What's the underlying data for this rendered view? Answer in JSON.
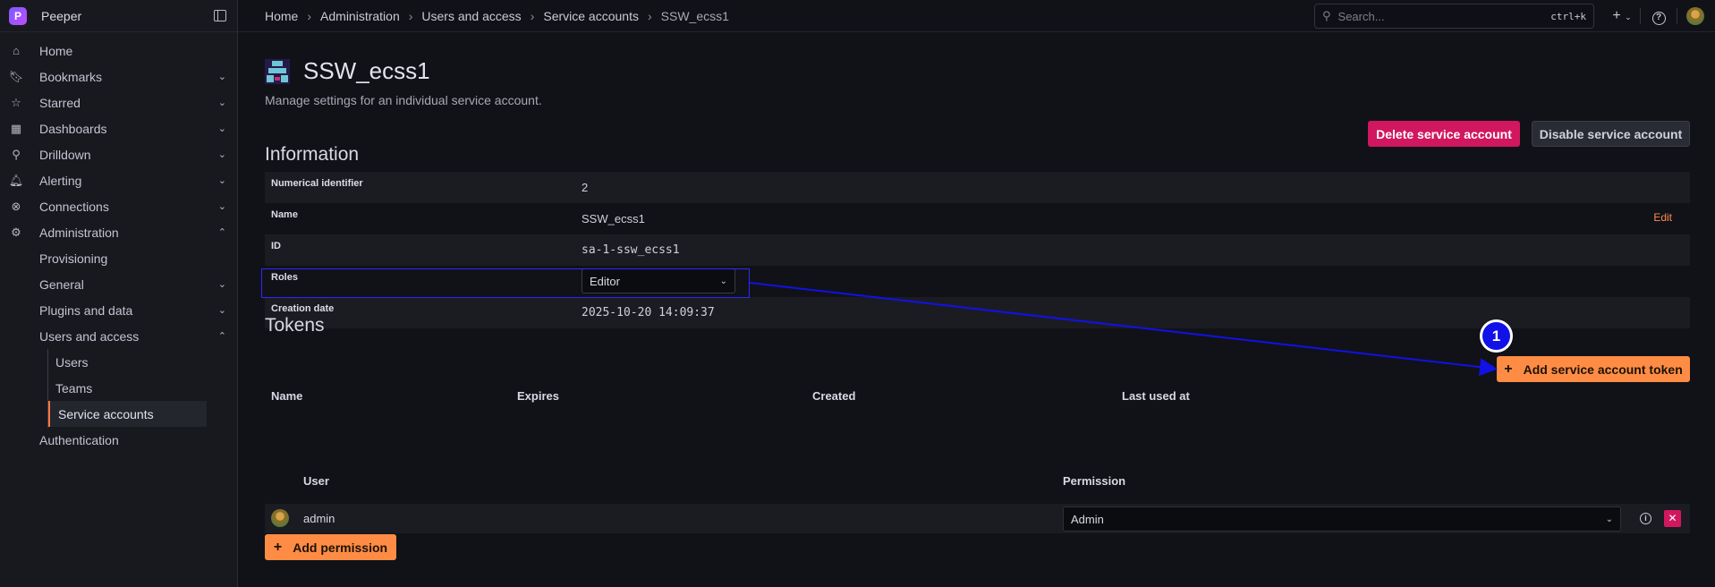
{
  "app": {
    "name": "Peeper"
  },
  "sidebar": {
    "items": [
      {
        "label": "Home",
        "icon": "home-icon"
      },
      {
        "label": "Bookmarks",
        "icon": "bookmark-icon"
      },
      {
        "label": "Starred",
        "icon": "star-icon"
      },
      {
        "label": "Dashboards",
        "icon": "dashboards-icon"
      },
      {
        "label": "Drilldown",
        "icon": "drilldown-icon"
      },
      {
        "label": "Alerting",
        "icon": "bell-icon"
      },
      {
        "label": "Connections",
        "icon": "connections-icon"
      },
      {
        "label": "Administration",
        "icon": "gear-icon"
      },
      {
        "label": "Provisioning"
      },
      {
        "label": "General"
      },
      {
        "label": "Plugins and data"
      },
      {
        "label": "Users and access"
      },
      {
        "label": "Users"
      },
      {
        "label": "Teams"
      },
      {
        "label": "Service accounts"
      },
      {
        "label": "Authentication"
      }
    ]
  },
  "breadcrumb": [
    "Home",
    "Administration",
    "Users and access",
    "Service accounts",
    "SSW_ecss1"
  ],
  "search": {
    "placeholder": "Search...",
    "shortcut": "ctrl+k"
  },
  "page": {
    "title": "SSW_ecss1",
    "subtitle": "Manage settings for an individual service account.",
    "delete_label": "Delete service account",
    "disable_label": "Disable service account"
  },
  "information": {
    "title": "Information",
    "rows": [
      {
        "label": "Numerical identifier",
        "value": "2"
      },
      {
        "label": "Name",
        "value": "SSW_ecss1",
        "action": "Edit"
      },
      {
        "label": "ID",
        "value": "sa-1-ssw_ecss1"
      },
      {
        "label": "Roles",
        "value": "Editor"
      },
      {
        "label": "Creation date",
        "value": "2025-10-20 14:09:37"
      }
    ]
  },
  "tokens": {
    "title": "Tokens",
    "add_label": "Add service account token",
    "columns": [
      "Name",
      "Expires",
      "Created",
      "Last used at"
    ]
  },
  "permissions": {
    "columns": [
      "User",
      "Permission"
    ],
    "rows": [
      {
        "user": "admin",
        "permission": "Admin"
      }
    ],
    "add_label": "Add permission"
  },
  "annotation": {
    "step": "1",
    "color": "#1111e8"
  },
  "colors": {
    "accent": "#ff8c44",
    "danger": "#d1175f",
    "background": "#111217"
  }
}
